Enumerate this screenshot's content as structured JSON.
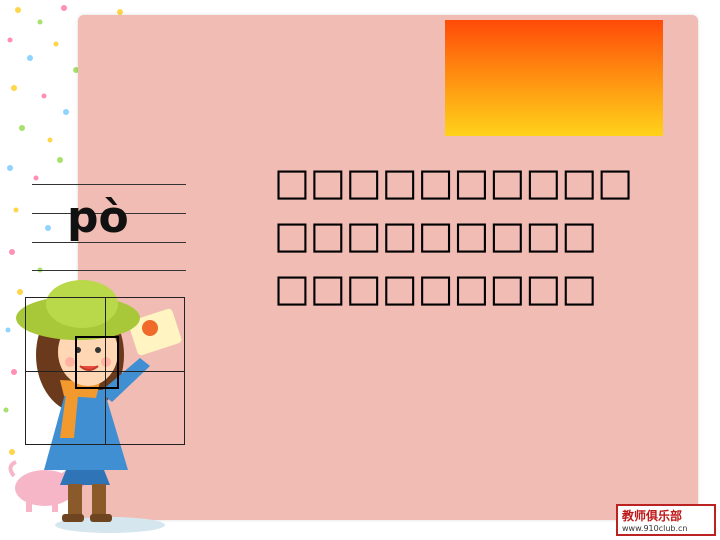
{
  "pinyin": "pò",
  "text_lines": [
    "□□□□□□□□□□",
    "□□□□□□□□□",
    "□□□□□□□□□"
  ],
  "logo": {
    "title": "教师俱乐部",
    "url": "www.910club.cn"
  },
  "colors": {
    "card": "#f1bcb4",
    "gradient_top": "#ff4a08",
    "gradient_bottom": "#ffd21a"
  }
}
